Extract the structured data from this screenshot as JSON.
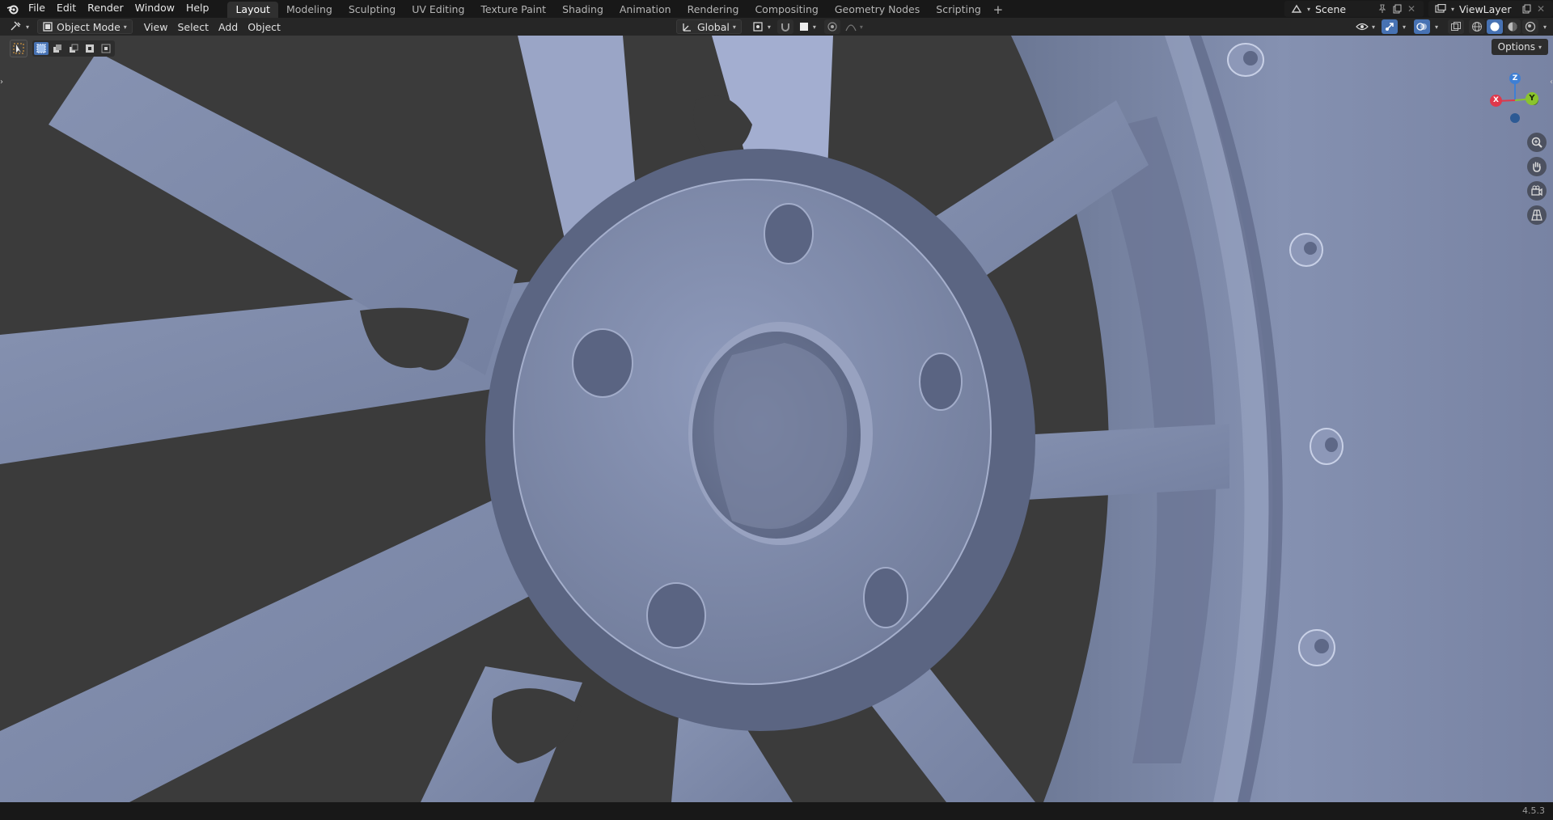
{
  "topbar": {
    "menu": [
      "File",
      "Edit",
      "Render",
      "Window",
      "Help"
    ],
    "workspaces": [
      "Layout",
      "Modeling",
      "Sculpting",
      "UV Editing",
      "Texture Paint",
      "Shading",
      "Animation",
      "Rendering",
      "Compositing",
      "Geometry Nodes",
      "Scripting"
    ],
    "active_workspace": "Layout",
    "add_tab": "+",
    "scene": "Scene",
    "view_layer": "ViewLayer"
  },
  "header": {
    "mode": "Object Mode",
    "menus": [
      "View",
      "Select",
      "Add",
      "Object"
    ],
    "transform_orientation": "Global"
  },
  "viewport": {
    "options_label": "Options",
    "gizmo": {
      "x": "X",
      "y": "Y",
      "z": "Z"
    },
    "colors": {
      "background": "#3c3c3c",
      "mesh": "#8a96b4",
      "x_axis": "#e0384b",
      "y_axis": "#8ac42d",
      "z_axis": "#3e7fd4",
      "accent": "#4772b3"
    }
  },
  "icons": [
    "blender-logo-icon",
    "editor-type-icon",
    "object-mode-icon",
    "select-box-tool-icon",
    "transform-orientation-icon",
    "pivot-icon",
    "snap-icon",
    "proportional-edit-icon",
    "visibility-icon",
    "gizmo-icon",
    "overlay-icon",
    "xray-icon",
    "wireframe-shading-icon",
    "solid-shading-icon",
    "material-shading-icon",
    "rendered-shading-icon",
    "zoom-icon",
    "pan-hand-icon",
    "camera-icon",
    "grid-icon"
  ],
  "status": {
    "version": "4.5.3"
  }
}
